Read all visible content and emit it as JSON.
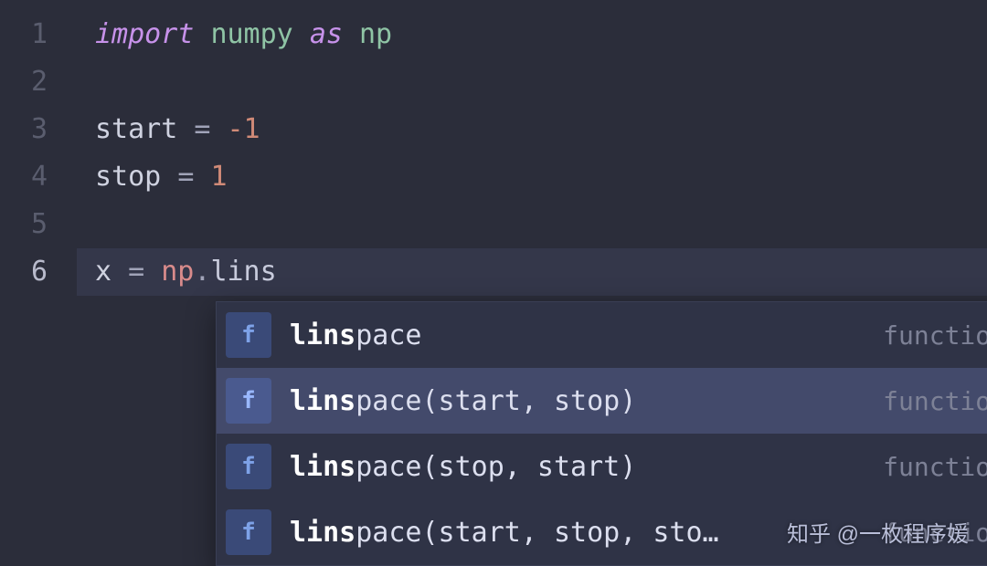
{
  "gutter": {
    "lines": [
      "1",
      "2",
      "3",
      "4",
      "5",
      "6"
    ],
    "current": 6
  },
  "code": {
    "l1": {
      "kw_import": "import",
      "mod": "numpy",
      "kw_as": "as",
      "alias": "np"
    },
    "l3": {
      "id": "start",
      "op": "=",
      "val": "-1"
    },
    "l4": {
      "id": "stop",
      "op": "=",
      "val": "1"
    },
    "l6": {
      "id": "x",
      "op": "=",
      "obj": "np",
      "dot": ".",
      "partial": "lins"
    }
  },
  "popup": {
    "icon_glyph": "f",
    "kind_label": "function",
    "match": "lins",
    "items": [
      {
        "rest": "pace"
      },
      {
        "rest": "pace(start, stop)"
      },
      {
        "rest": "pace(stop, start)"
      },
      {
        "rest": "pace(start, stop, sto…"
      }
    ],
    "selected": 1
  },
  "watermark": "知乎 @一枚程序媛"
}
